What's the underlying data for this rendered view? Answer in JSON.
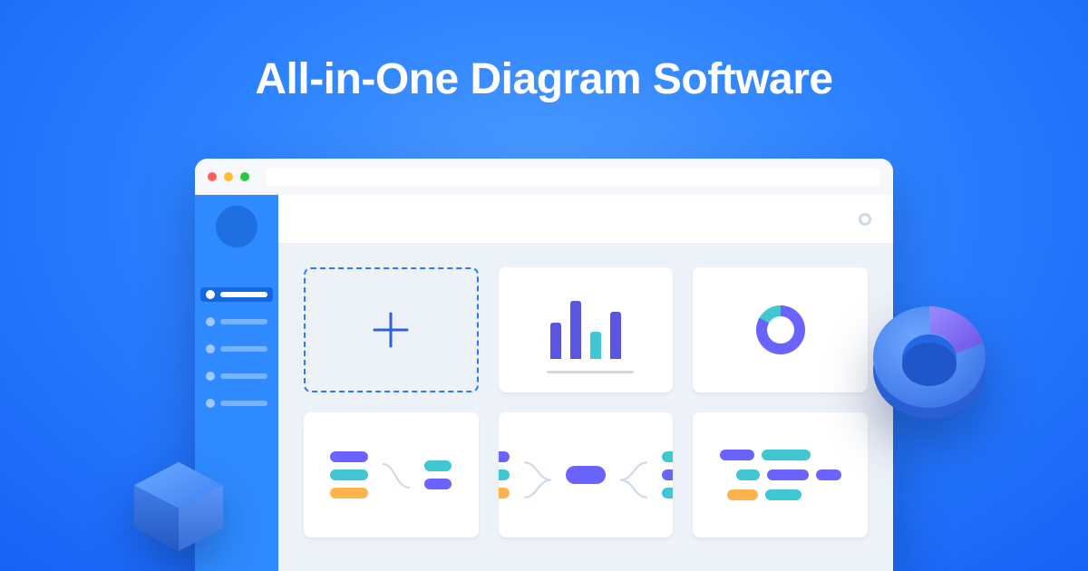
{
  "hero": {
    "title": "All-in-One Diagram Software"
  },
  "colors": {
    "purple": "#6a63ff",
    "teal": "#41c7d1",
    "orange": "#ffb34d",
    "blue": "#2f8bff"
  }
}
